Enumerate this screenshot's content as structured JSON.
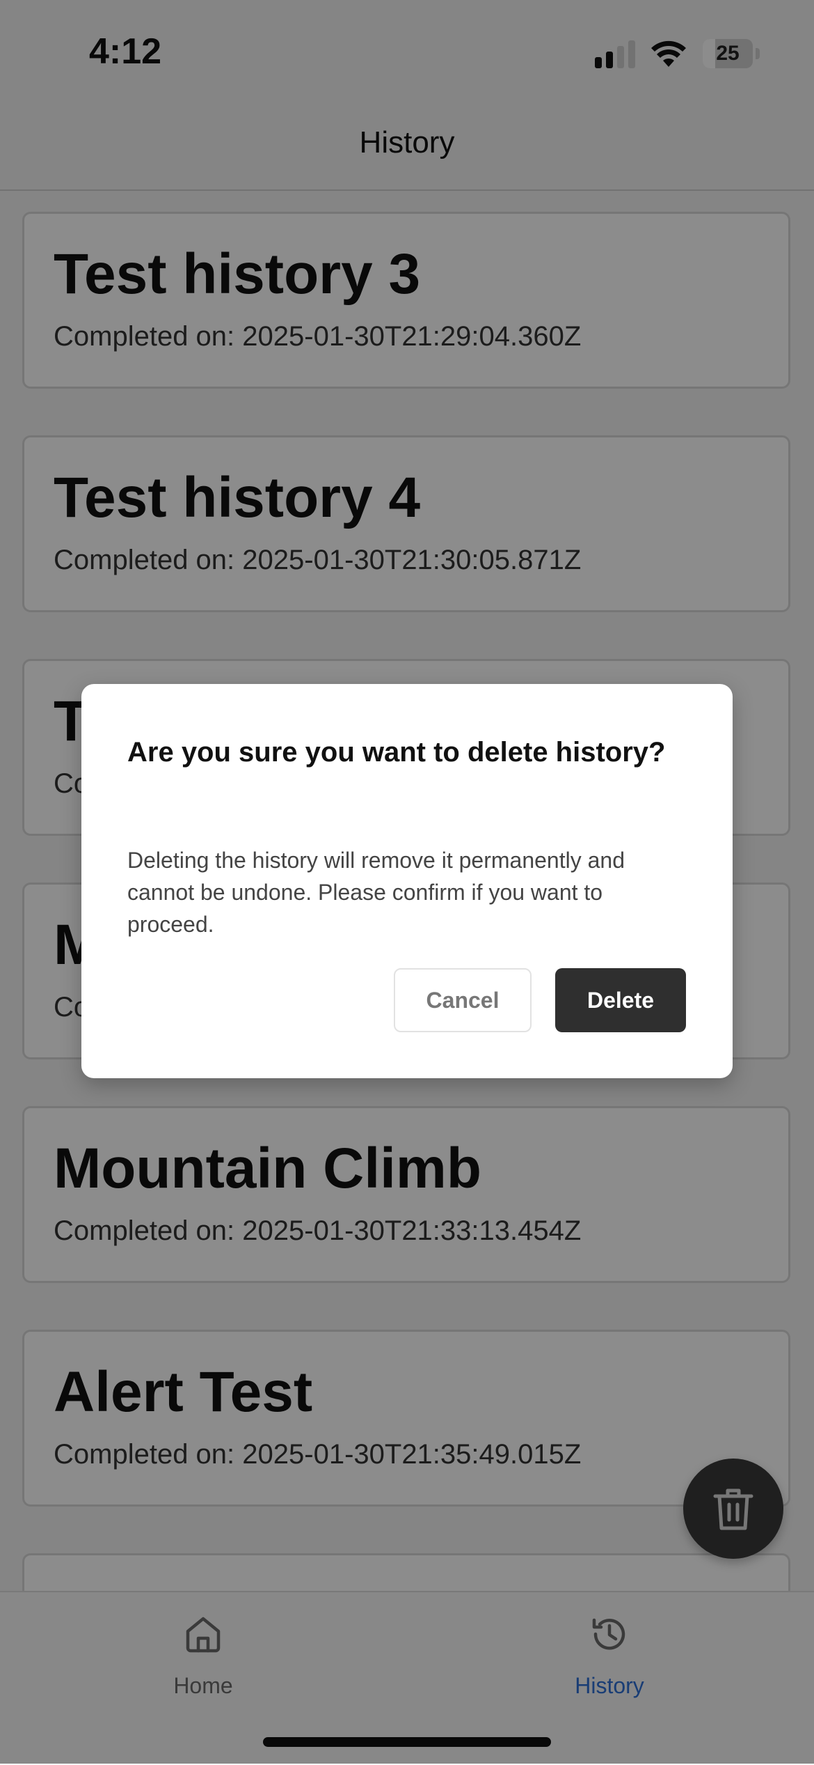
{
  "status_bar": {
    "time": "4:12",
    "battery_level": "25",
    "battery_fraction": 0.25
  },
  "header": {
    "title": "History"
  },
  "history": {
    "items": [
      {
        "title": "Test history 3",
        "completed": "Completed on: 2025-01-30T21:29:04.360Z"
      },
      {
        "title": "Test history 4",
        "completed": "Completed on: 2025-01-30T21:30:05.871Z"
      },
      {
        "title": "T",
        "completed": "Co"
      },
      {
        "title": "M",
        "completed": "Co"
      },
      {
        "title": "Mountain Climb",
        "completed": "Completed on: 2025-01-30T21:33:13.454Z"
      },
      {
        "title": "Alert Test",
        "completed": "Completed on: 2025-01-30T21:35:49.015Z"
      },
      {
        "title": "",
        "completed": ""
      }
    ]
  },
  "dialog": {
    "title": "Are you sure you want to delete history?",
    "message": "Deleting the history will remove it permanently and cannot be undone. Please confirm if you want to proceed.",
    "cancel_label": "Cancel",
    "delete_label": "Delete"
  },
  "tab_bar": {
    "tabs": [
      {
        "label": "Home",
        "icon": "home-icon",
        "active": false
      },
      {
        "label": "History",
        "icon": "history-icon",
        "active": true
      }
    ]
  },
  "fab": {
    "icon": "trash-icon"
  },
  "colors": {
    "active_tab": "#2f6fd6",
    "inactive_tab": "#6b6b6b",
    "dark_button": "#2f2f2f"
  }
}
